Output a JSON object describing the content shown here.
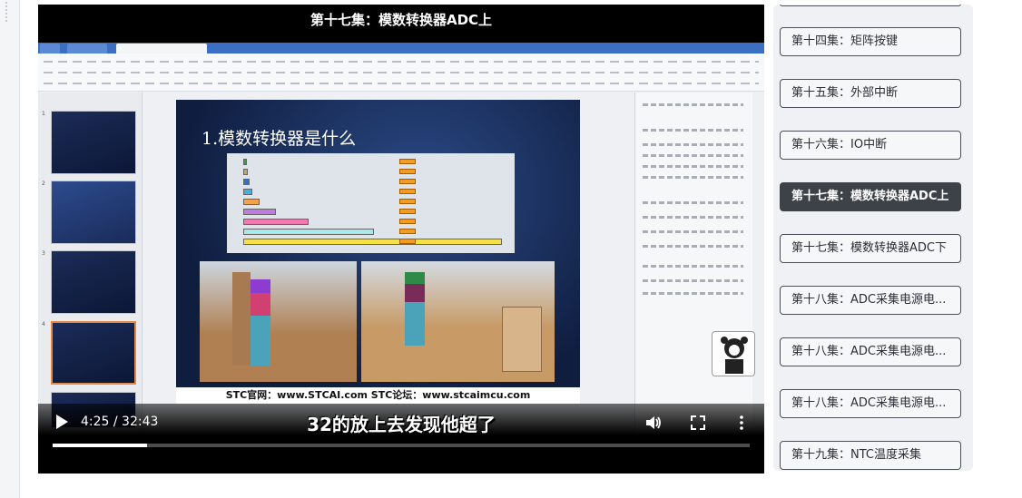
{
  "player": {
    "title": "第十七集：模数转换器ADC上",
    "slide_heading": "1.模数转换器是什么",
    "slide_footer": "STC官网：www.STCAI.com      STC论坛：www.stcaimcu.com",
    "subtitle": "32的放上去发现他超了",
    "time": "4:25 / 32:43",
    "progress_fraction": 0.135,
    "icons": [
      "play-icon",
      "volume-icon",
      "fullscreen-icon",
      "more-icon"
    ]
  },
  "playlist": {
    "episodes": [
      {
        "label": "第十四集：矩阵按键",
        "active": false
      },
      {
        "label": "第十五集：外部中断",
        "active": false
      },
      {
        "label": "第十六集：IO中断",
        "active": false
      },
      {
        "label": "第十七集：模数转换器ADC上",
        "active": true
      },
      {
        "label": "第十七集：模数转换器ADC下",
        "active": false
      },
      {
        "label": "第十八集：ADC采集电源电...",
        "active": false
      },
      {
        "label": "第十八集：ADC采集电源电...",
        "active": false
      },
      {
        "label": "第十八集：ADC采集电源电...",
        "active": false
      },
      {
        "label": "第十九集：NTC温度采集",
        "active": false
      }
    ]
  },
  "colors": {
    "active_episode": "#3d4148",
    "episode_border": "#4b4f57",
    "accent_bar": "#f39c1f"
  }
}
